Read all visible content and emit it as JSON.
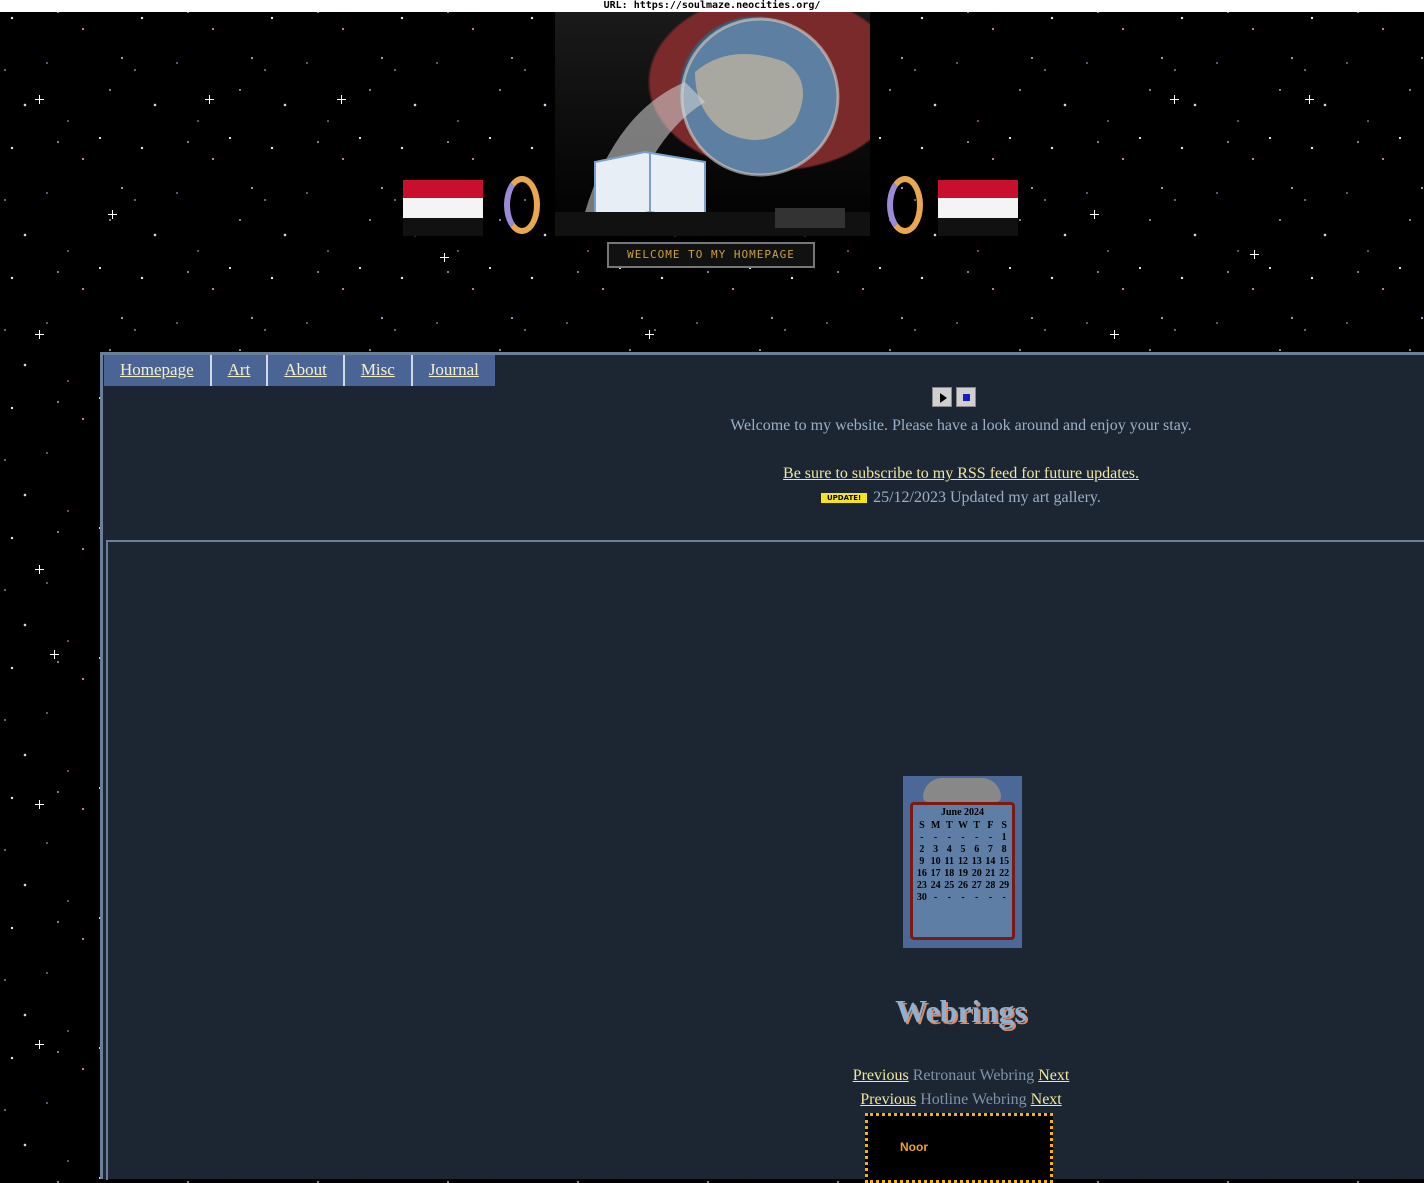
{
  "browser": {
    "url_label": "URL: https://soulmaze.neocities.org/"
  },
  "header": {
    "marquee_text": "WELCOME TO MY HOMEPAGE"
  },
  "nav": {
    "items": [
      {
        "label": "Homepage"
      },
      {
        "label": "Art"
      },
      {
        "label": "About"
      },
      {
        "label": "Misc"
      },
      {
        "label": "Journal"
      }
    ]
  },
  "intro": {
    "welcome": "Welcome to my website. Please have a look around and enjoy your stay.",
    "rss_link": "Be sure to subscribe to my RSS feed for future updates.",
    "update_badge": "UPDATE!",
    "update_text": "25/12/2023 Updated my art gallery."
  },
  "calendar": {
    "title": "June 2024",
    "days": [
      "S",
      "M",
      "T",
      "W",
      "T",
      "F",
      "S"
    ],
    "cells": [
      "-",
      "-",
      "-",
      "-",
      "-",
      "-",
      "1",
      "2",
      "3",
      "4",
      "5",
      "6",
      "7",
      "8",
      "9",
      "10",
      "11",
      "12",
      "13",
      "14",
      "15",
      "16",
      "17",
      "18",
      "19",
      "20",
      "21",
      "22",
      "23",
      "24",
      "25",
      "26",
      "27",
      "28",
      "29",
      "30",
      "-",
      "-",
      "-",
      "-",
      "-",
      "-"
    ]
  },
  "webrings": {
    "title": "Webrings",
    "rings": [
      {
        "prev": "Previous",
        "name": "Retronaut Webring",
        "next": "Next"
      },
      {
        "prev": "Previous",
        "name": "Hotline Webring",
        "next": "Next"
      }
    ],
    "noor_label": "Noor"
  },
  "colors": {
    "panel_bg": "#1c2632",
    "nav_bg": "#4b6496",
    "link": "#f0e6a0",
    "text": "#9ab0c7"
  }
}
